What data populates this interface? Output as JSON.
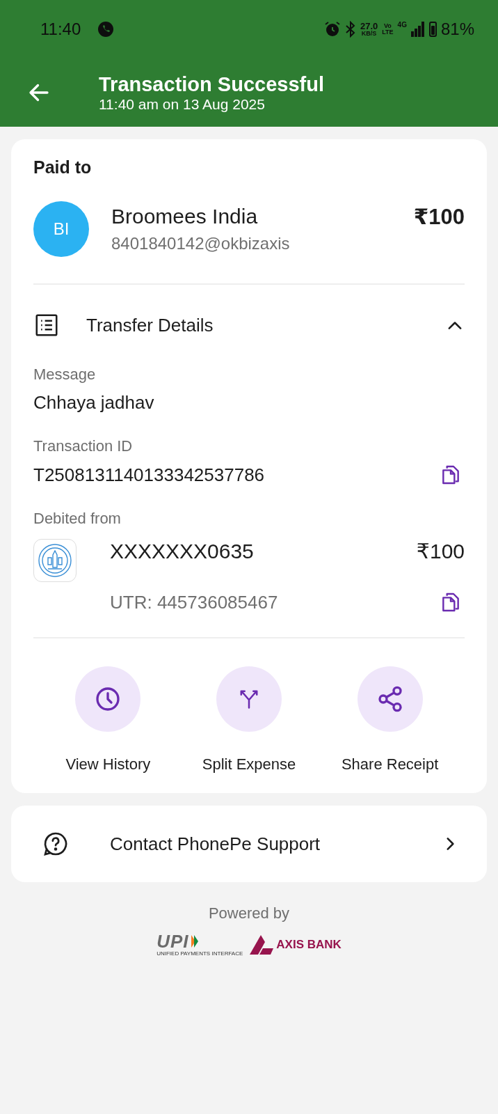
{
  "status_bar": {
    "time": "11:40",
    "speed": "27.0",
    "speed_unit": "KB/S",
    "volte_top": "Vo",
    "volte_bottom": "LTE",
    "network": "4G",
    "battery": "81%"
  },
  "header": {
    "title": "Transaction Successful",
    "subtitle": "11:40 am on 13 Aug 2025"
  },
  "payee": {
    "heading": "Paid to",
    "initials": "BI",
    "name": "Broomees India",
    "upi_id": "8401840142@okbizaxis",
    "amount": "₹100"
  },
  "details": {
    "title": "Transfer Details",
    "expanded": true,
    "fields": [
      {
        "kind": "text",
        "label": "Message",
        "value": "Chhaya jadhav"
      },
      {
        "kind": "copy",
        "label": "Transaction ID",
        "value": "T2508131140133342537786"
      }
    ],
    "debit": {
      "label": "Debited from",
      "account": "XXXXXXX0635",
      "amount": "₹100",
      "utr": "UTR: 445736085467"
    }
  },
  "actions": [
    {
      "kind": "history",
      "label": "View History"
    },
    {
      "kind": "split",
      "label": "Split Expense"
    },
    {
      "kind": "share",
      "label": "Share Receipt"
    }
  ],
  "support": {
    "label": "Contact PhonePe Support"
  },
  "footer": {
    "powered_by": "Powered by",
    "upi": "UPI",
    "upi_tagline": "UNIFIED PAYMENTS INTERFACE",
    "bank": "AXIS BANK"
  }
}
